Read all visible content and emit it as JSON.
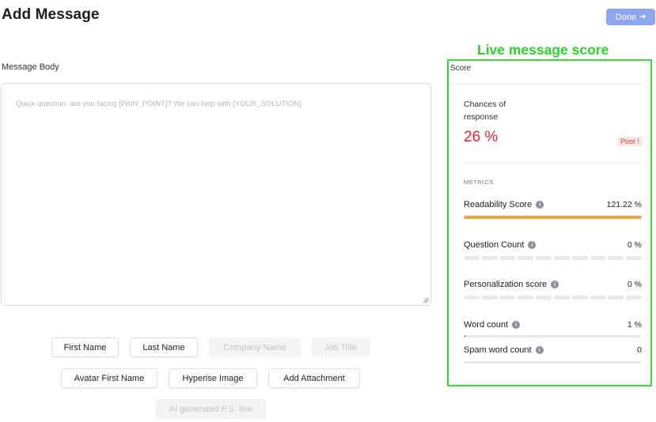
{
  "header": {
    "title": "Add Message",
    "done_label": "Done",
    "done_icon": "arrow-right-icon"
  },
  "editor": {
    "section_label": "Message Body",
    "value": "",
    "placeholder": "Quick question: are you facing [PAIN_POINT]? We can help with [YOUR_SOLUTION]"
  },
  "variables": [
    {
      "label": "First Name",
      "enabled": true
    },
    {
      "label": "Last Name",
      "enabled": true
    },
    {
      "label": "Company Name",
      "enabled": false
    },
    {
      "label": "Job Title",
      "enabled": false
    },
    {
      "label": "Avatar First Name",
      "enabled": true
    },
    {
      "label": "Hyperise Image",
      "enabled": true
    },
    {
      "label": "Add Attachment",
      "enabled": true
    },
    {
      "label": "AI generated P.S. line",
      "enabled": false
    }
  ],
  "annotation": {
    "label": "Live message score",
    "color": "#33dd33"
  },
  "score": {
    "header": "Score",
    "chances_label": "Chances of response",
    "chances_value": "26 %",
    "rating_badge": "Poor !",
    "metrics_heading": "METRICS",
    "metrics": [
      {
        "name": "Readability Score",
        "value": "121.22 %",
        "fill": 1.0,
        "style": "bar"
      },
      {
        "name": "Question Count",
        "value": "0 %",
        "fill": 0.0,
        "style": "segments",
        "segments": 10
      },
      {
        "name": "Personalization score",
        "value": "0 %",
        "fill": 0.0,
        "style": "segments",
        "segments": 10
      },
      {
        "name": "Word count",
        "value": "1 %",
        "fill": 0.01,
        "style": "thin"
      },
      {
        "name": "Spam word count",
        "value": "0",
        "fill": 0.0,
        "style": "thin"
      }
    ]
  },
  "colors": {
    "accent": "#8ea6ee",
    "danger": "#e0232b",
    "readability_bar": "#f0a43a"
  }
}
